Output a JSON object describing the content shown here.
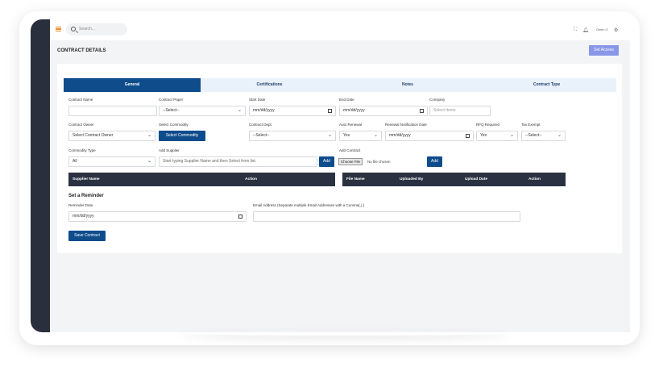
{
  "topbar": {
    "search_placeholder": "Search...",
    "user_name": "Owen G"
  },
  "page": {
    "title": "CONTRACT DETAILS",
    "set_access_label": "Set Access"
  },
  "tabs": [
    {
      "label": "General",
      "active": true
    },
    {
      "label": "Certifications",
      "active": false
    },
    {
      "label": "Notes",
      "active": false
    },
    {
      "label": "Contract Type",
      "active": false
    }
  ],
  "form": {
    "contract_name": {
      "label": "Contract Name",
      "value": ""
    },
    "contract_paper": {
      "label": "Contract Paper",
      "value": "--Select--"
    },
    "start_date": {
      "label": "Start Date",
      "value": "mm/dd/yyyy"
    },
    "end_date": {
      "label": "End Date",
      "value": "mm/dd/yyyy"
    },
    "company": {
      "label": "Company",
      "placeholder": "Select Items"
    },
    "contract_owner": {
      "label": "Contract Owner",
      "value": "Select Contract Owner"
    },
    "select_commodity": {
      "label": "Select Commodity",
      "button": "Select Commodity"
    },
    "contract_dept": {
      "label": "Contract Dept.",
      "value": "--Select--"
    },
    "auto_renewal": {
      "label": "Auto Renewal",
      "value": "Yes"
    },
    "renewal_notification_date": {
      "label": "Renewal Notification Date",
      "value": "mm/dd/yyyy"
    },
    "rfq_required": {
      "label": "RFQ Required",
      "value": "Yes"
    },
    "tax_exempt": {
      "label": "Tax Exempt",
      "value": "--Select--"
    },
    "commodity_type": {
      "label": "Commodity Type",
      "value": "All"
    },
    "add_supplier": {
      "label": "Add Supplier",
      "placeholder": "Start typing Supplier Name and then Select from list.",
      "button": "Add"
    },
    "add_contract": {
      "label": "Add Contract",
      "choose_file": "Choose File",
      "file_status": "No file chosen",
      "button": "Add"
    }
  },
  "supplier_table": {
    "columns": [
      "Supplier Name",
      "Action"
    ]
  },
  "file_table": {
    "columns": [
      "File Name",
      "Uploaded By",
      "Upload Date",
      "Action"
    ]
  },
  "reminder": {
    "section_title": "Set a Reminder",
    "date_label": "Reminder Date",
    "date_value": "mm/dd/yyyy",
    "email_label": "Email Address (Separate multiple Email Addresses with a Comma(,).)",
    "email_value": ""
  },
  "save_button": "Save Contract",
  "colors": {
    "primary": "#0e4c8c",
    "accent": "#f08a24",
    "set_access": "#8a97e8",
    "sidebar": "#2a2f3e",
    "table_header": "#2a3140"
  }
}
